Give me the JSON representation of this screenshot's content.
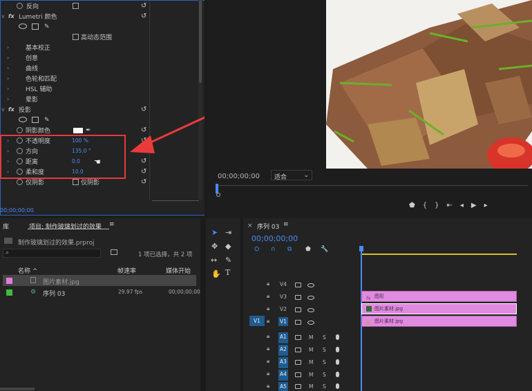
{
  "effects": {
    "reverse_label": "反向",
    "lumetri_label": "Lumetri 颜色",
    "hdr_label": "高动态范围",
    "basic_label": "基本校正",
    "creative_label": "创意",
    "curves_label": "曲线",
    "wheels_label": "色轮和匹配",
    "hsl_label": "HSL 辅助",
    "vignette_label": "晕影",
    "shadow_label": "投影",
    "shadow_color_label": "阴影颜色",
    "opacity_label": "不透明度",
    "opacity_value": "100 %",
    "direction_label": "方向",
    "direction_value": "135.0 °",
    "distance_label": "距离",
    "distance_value": "0.0",
    "softness_label": "柔和度",
    "softness_value": "10.0",
    "shadow_only_label": "仅阴影",
    "shadow_only_cb_label": "仅阴影",
    "timecode": "00;00;00;00"
  },
  "program": {
    "timecode": "00;00;00;00",
    "fit_label": "适合"
  },
  "project": {
    "lib_tab": "库",
    "title": "项目: 制作玻璃划过的效果",
    "file": "制作玻璃划过的效果.prproj",
    "selection": "1 项已选择，共 2 项",
    "col_name": "名称",
    "col_fps": "帧速率",
    "col_start": "媒体开始",
    "items": [
      {
        "name": "图片素材.jpg",
        "fps": "",
        "start": "",
        "color": "#e07be0"
      },
      {
        "name": "序列 03",
        "fps": "29.97 fps",
        "start": "00;00;00;00",
        "color": "#3dbb3d"
      }
    ]
  },
  "timeline": {
    "title": "序列 03",
    "timecode": "00;00;00;00",
    "v1_source": "V1",
    "tracks": [
      "V4",
      "V3",
      "V2",
      "V1",
      "A1",
      "A2",
      "A3",
      "A4",
      "A5"
    ],
    "mute": "M",
    "solo": "S",
    "clips": [
      {
        "name": "图形"
      },
      {
        "name": "图片素材.jpg"
      },
      {
        "name": "图片素材.jpg"
      }
    ]
  },
  "colors": {
    "accent": "#4a8af4",
    "highlight": "#e33b3b",
    "clip": "#e08ae0"
  }
}
